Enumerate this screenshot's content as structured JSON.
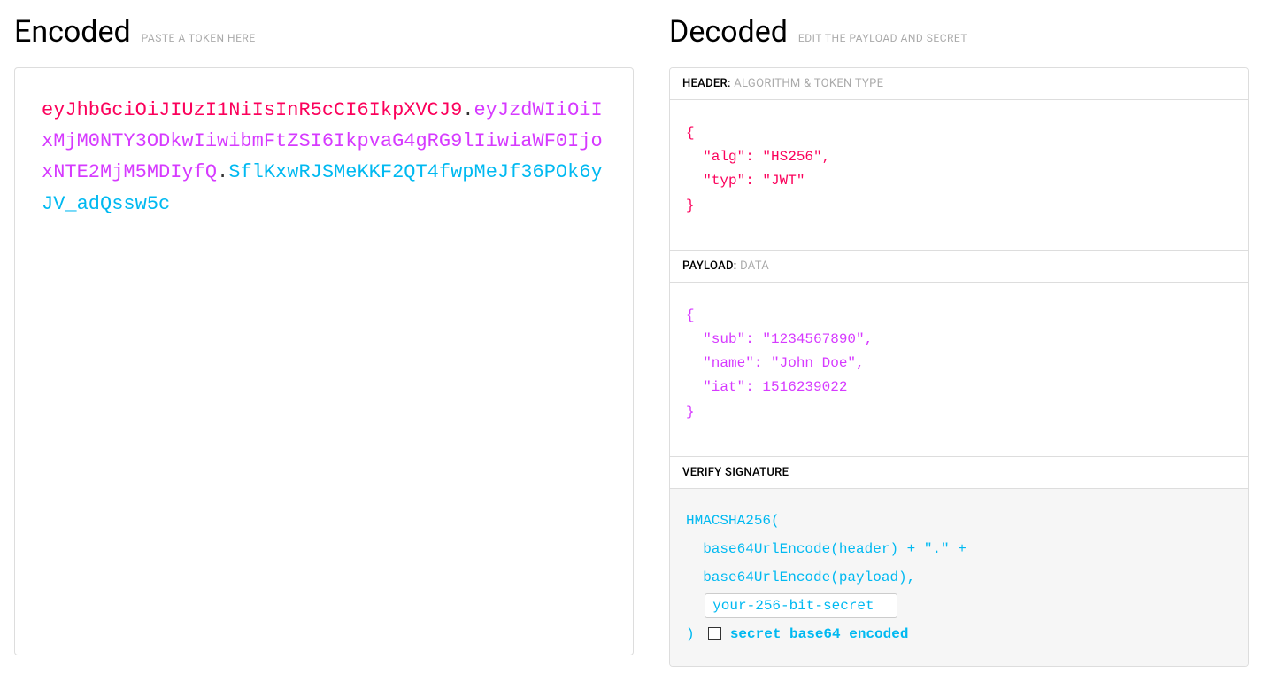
{
  "encoded": {
    "title": "Encoded",
    "subtitle": "PASTE A TOKEN HERE",
    "token_header": "eyJhbGciOiJIUzI1NiIsInR5cCI6IkpXVCJ9",
    "token_payload": "eyJzdWIiOiIxMjM0NTY3ODkwIiwibmFtZSI6IkpvaG4gRG9lIiwiaWF0IjoxNTE2MjM5MDIyfQ",
    "token_signature": "SflKxwRJSMeKKF2QT4fwpMeJf36POk6yJV_adQssw5c",
    "dot": "."
  },
  "decoded": {
    "title": "Decoded",
    "subtitle": "EDIT THE PAYLOAD AND SECRET",
    "header_section": {
      "label": "HEADER:",
      "sub": "ALGORITHM & TOKEN TYPE",
      "json": "{\n  \"alg\": \"HS256\",\n  \"typ\": \"JWT\"\n}"
    },
    "payload_section": {
      "label": "PAYLOAD:",
      "sub": "DATA",
      "json": "{\n  \"sub\": \"1234567890\",\n  \"name\": \"John Doe\",\n  \"iat\": 1516239022\n}"
    },
    "verify_section": {
      "label": "VERIFY SIGNATURE",
      "line1": "HMACSHA256(",
      "line2": "  base64UrlEncode(header) + \".\" +",
      "line3": "  base64UrlEncode(payload),",
      "secret_value": "your-256-bit-secret",
      "close_paren": ") ",
      "checkbox_label": "secret base64 encoded"
    }
  }
}
